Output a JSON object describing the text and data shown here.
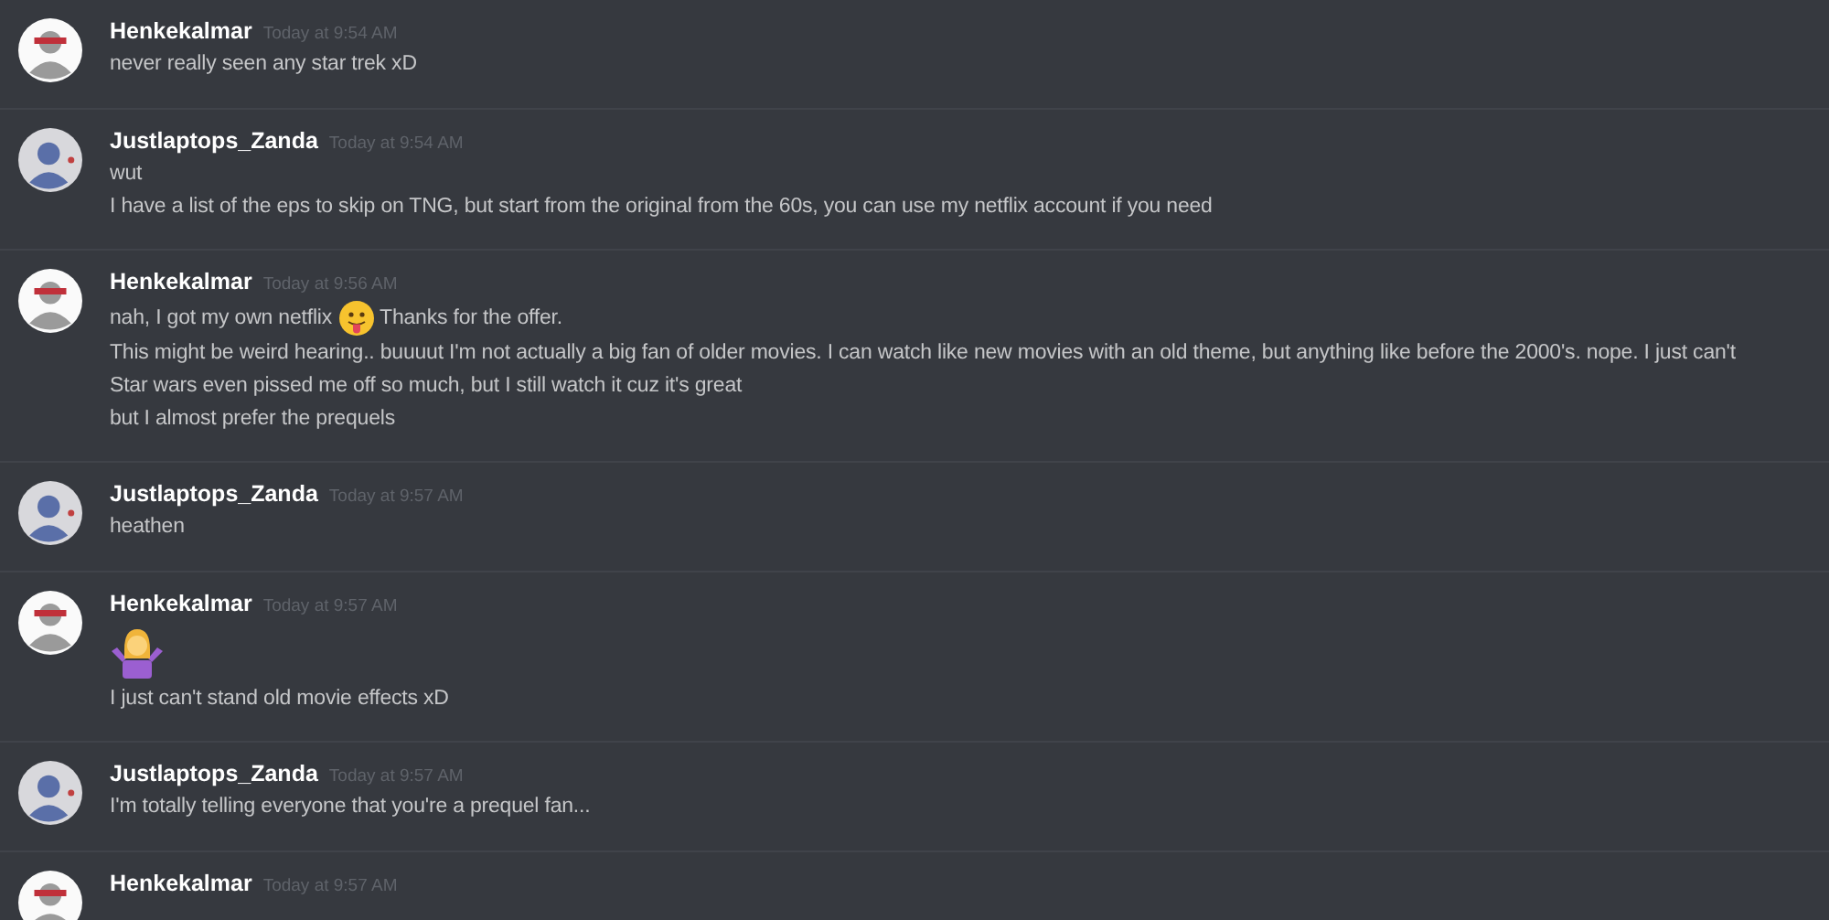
{
  "messages": [
    {
      "author": "Henkekalmar",
      "kind": "user_a",
      "timestamp": "Today at 9:54 AM",
      "lines": [
        {
          "kind": "text",
          "text": "never really seen any star trek xD"
        }
      ]
    },
    {
      "author": "Justlaptops_Zanda",
      "kind": "user_b",
      "timestamp": "Today at 9:54 AM",
      "lines": [
        {
          "kind": "text",
          "text": "wut"
        },
        {
          "kind": "text",
          "text": "I have a list of the eps to skip on TNG, but start from the original from the 60s, you can use my netflix account if you need"
        }
      ]
    },
    {
      "author": "Henkekalmar",
      "kind": "user_a",
      "timestamp": "Today at 9:56 AM",
      "lines": [
        {
          "kind": "inline_emoji",
          "before": "nah, I got my own netflix",
          "after": "Thanks for the offer."
        },
        {
          "kind": "text",
          "text": "This might be weird hearing.. buuuut I'm not actually a big fan of older movies. I can watch like new movies with an old theme, but anything like before the 2000's. nope. I just can't"
        },
        {
          "kind": "text",
          "text": "Star wars even pissed me off so much, but I still watch it cuz it's great"
        },
        {
          "kind": "text",
          "text": "but I almost prefer the prequels"
        }
      ]
    },
    {
      "author": "Justlaptops_Zanda",
      "kind": "user_b",
      "timestamp": "Today at 9:57 AM",
      "lines": [
        {
          "kind": "text",
          "text": "heathen"
        }
      ]
    },
    {
      "author": "Henkekalmar",
      "kind": "user_a",
      "timestamp": "Today at 9:57 AM",
      "lines": [
        {
          "kind": "big_emoji"
        },
        {
          "kind": "text",
          "text": "I just can't stand old movie effects xD"
        }
      ]
    },
    {
      "author": "Justlaptops_Zanda",
      "kind": "user_b",
      "timestamp": "Today at 9:57 AM",
      "lines": [
        {
          "kind": "text",
          "text": "I'm totally telling everyone that you're a prequel fan..."
        }
      ]
    },
    {
      "author": "Henkekalmar",
      "kind": "user_a",
      "timestamp": "Today at 9:57 AM"
    }
  ]
}
